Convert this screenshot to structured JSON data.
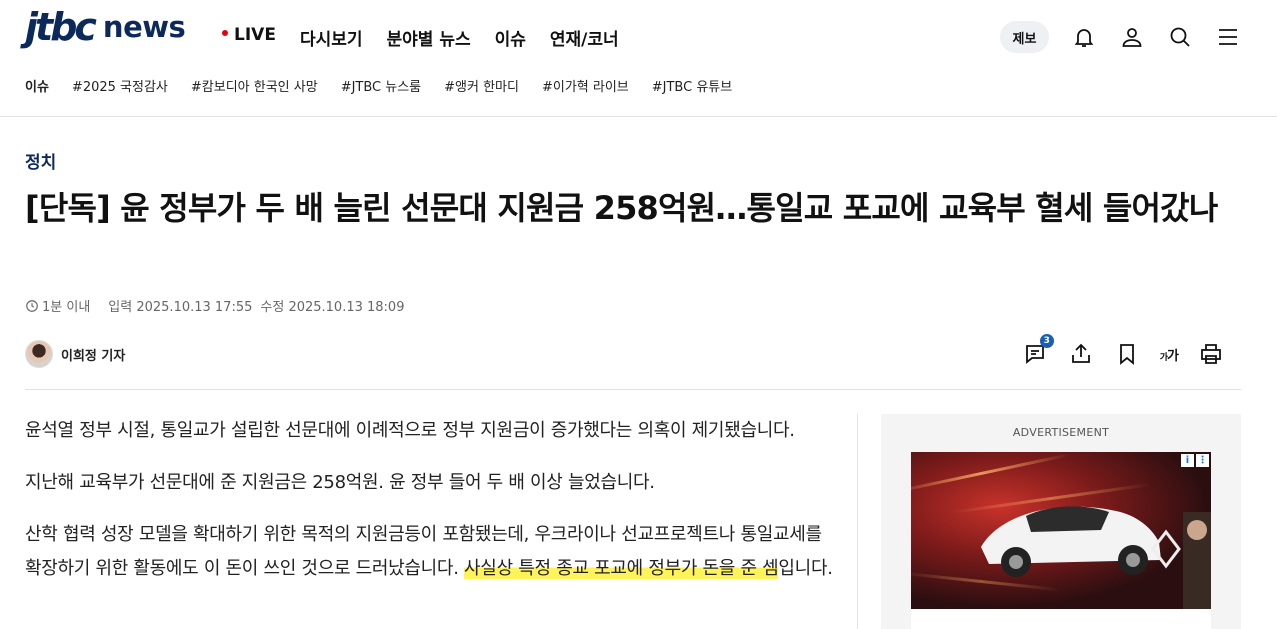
{
  "header": {
    "util_links": [
      "",
      "",
      ""
    ],
    "logo_brand": "jtbc",
    "logo_news": "news",
    "nav": [
      {
        "label": "LIVE",
        "live": true
      },
      {
        "label": "다시보기"
      },
      {
        "label": "분야별 뉴스"
      },
      {
        "label": "이슈"
      },
      {
        "label": "연재/코너"
      }
    ],
    "report_label": "제보",
    "icons": [
      "bell-icon",
      "user-icon",
      "search-icon",
      "menu-icon"
    ]
  },
  "tagbar": {
    "head": "이슈",
    "tags": [
      "#2025 국정감사",
      "#캄보디아 한국인 사망",
      "#JTBC 뉴스룸",
      "#앵커 한마디",
      "#이가혁 라이브",
      "#JTBC 유튜브"
    ]
  },
  "article": {
    "section": "정치",
    "headline": "[단독] 윤 정부가 두 배 늘린 선문대 지원금 258억원…통일교 포교에 교육부 혈세 들어갔나",
    "read_time": "1분 이내",
    "published": "입력 2025.10.13 17:55",
    "updated": "수정 2025.10.13 18:09",
    "reporter": "이희정 기자",
    "comment_count": "3",
    "font_btn_small": "가",
    "font_btn_large": "가",
    "paragraphs": [
      "윤석열 정부 시절, 통일교가 설립한 선문대에 이례적으로 정부 지원금이 증가했다는 의혹이 제기됐습니다.",
      "지난해 교육부가 선문대에 준 지원금은 258억원. 윤 정부 들어 두 배 이상 늘었습니다."
    ],
    "para3_plain": "산학 협력 성장 모델을 확대하기 위한 목적의 지원금등이 포함됐는데, 우크라이나 선교프로젝트나 통일교세를 확장하기 위한 활동에도 이 돈이 쓰인 것으로 드러났습니다. ",
    "para3_highlight": "사실상 특정 종교 포교에 정부가 돈을 준 셈",
    "para3_tail": "입니다."
  },
  "ad": {
    "label": "ADVERTISEMENT",
    "info_icon": "i",
    "menu_icon": "⋮"
  },
  "colors": {
    "brand": "#0b2a5b",
    "live_dot": "#e60012",
    "highlight": "#fff35a",
    "badge": "#1a5fb4"
  }
}
